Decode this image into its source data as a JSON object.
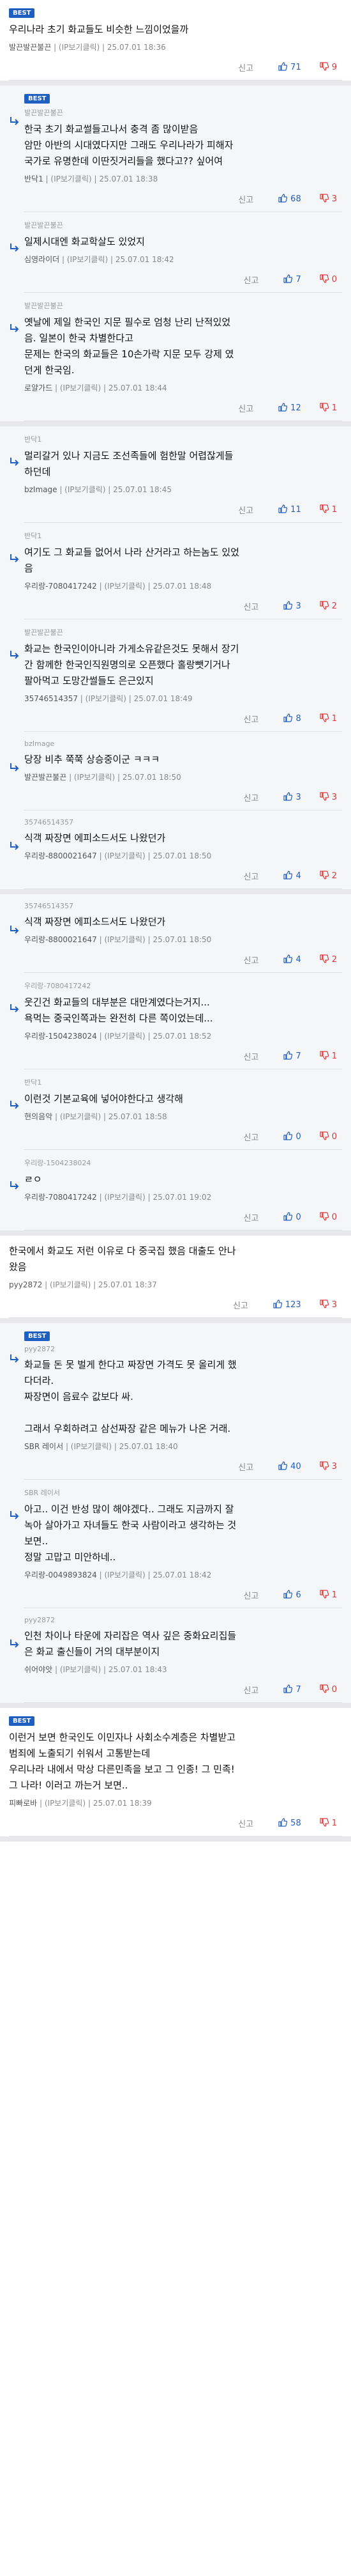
{
  "ui": {
    "report_label": "신고",
    "best_label": "BEST",
    "colors": {
      "best_badge": "#1f5fc0",
      "upvote": "#1f5fc0",
      "downvote": "#d63a3a"
    },
    "icons": {
      "up": "thumbs-up-icon",
      "down": "thumbs-down-icon",
      "reply": "reply-arrow-icon"
    }
  },
  "threads": [
    {
      "comments": [
        {
          "kind": "top",
          "best": true,
          "text": "우리나라 초기 화교들도 비슷한 느낌이었을까",
          "nick": "발끈발끈불끈",
          "ip": "(IP보기클릭)",
          "date": "25.07.01 18:36",
          "up": "71",
          "down": "9"
        }
      ]
    },
    {
      "comments": [
        {
          "kind": "reply",
          "best": true,
          "parent": "발끈발끈불끈",
          "text": "한국 초기 화교썰들고나서 충격 좀 많이받음\n암만 아반의 시대였다지만 그래도 우리나라가 피해자\n국가로 유명한데 이딴짓거리들을 했다고?? 싶어여",
          "nick": "반닥1",
          "ip": "(IP보기클릭)",
          "date": "25.07.01 18:38",
          "up": "68",
          "down": "3"
        },
        {
          "kind": "reply",
          "best": false,
          "parent": "발끈발끈불끈",
          "text": "일제시대엔 화교학살도 있었지",
          "nick": "심영라이더",
          "ip": "(IP보기클릭)",
          "date": "25.07.01 18:42",
          "up": "7",
          "down": "0"
        },
        {
          "kind": "reply",
          "best": false,
          "parent": "발끈발끈불끈",
          "text": "옛날에 제일 한국인 지문 필수로 엄청 난리 난적있었\n음. 일본이 한국 차별한다고\n문제는 한국의 화교들은 10손가락 지문 모두 강제 였\n던게 한국임.",
          "nick": "로얄가드",
          "ip": "(IP보기클릭)",
          "date": "25.07.01 18:44",
          "up": "12",
          "down": "1"
        }
      ]
    },
    {
      "comments": [
        {
          "kind": "reply",
          "best": false,
          "parent": "반닥1",
          "text": "멀리갈거 있나 지금도 조선족들에 험한말 어렵잖게들\n하던데",
          "nick": "bzImage",
          "ip": "(IP보기클릭)",
          "date": "25.07.01 18:45",
          "up": "11",
          "down": "1"
        },
        {
          "kind": "reply",
          "best": false,
          "parent": "반닥1",
          "text": "여기도 그 화교들 없어서 나라 산거라고 하는놈도 있었\n음",
          "nick": "우리랑-7080417242",
          "ip": "(IP보기클릭)",
          "date": "25.07.01 18:48",
          "up": "3",
          "down": "2"
        },
        {
          "kind": "reply",
          "best": false,
          "parent": "발끈발끈불끈",
          "text": "화교는 한국인이아니라 가게소유같은것도 못해서 장기\n간 함께한 한국인직원명의로 오픈했다 홀랑뺏기거나\n팔아먹고 도망간썰들도 은근있지",
          "nick": "35746514357",
          "ip": "(IP보기클릭)",
          "date": "25.07.01 18:49",
          "up": "8",
          "down": "1"
        },
        {
          "kind": "reply",
          "best": false,
          "parent": "bzImage",
          "text": "당장 비추 쭉쭉 상승중이군 ㅋㅋㅋ",
          "nick": "발끈발끈불끈",
          "ip": "(IP보기클릭)",
          "date": "25.07.01 18:50",
          "up": "3",
          "down": "3"
        },
        {
          "kind": "reply",
          "best": false,
          "parent": "35746514357",
          "text": "식객 짜장면 에피소드서도 나왔던가",
          "nick": "우리랑-8800021647",
          "ip": "(IP보기클릭)",
          "date": "25.07.01 18:50",
          "up": "4",
          "down": "2"
        }
      ]
    },
    {
      "comments": [
        {
          "kind": "reply",
          "best": false,
          "parent": "35746514357",
          "text": "식객 짜장면 에피소드서도 나왔던가",
          "nick": "우리랑-8800021647",
          "ip": "(IP보기클릭)",
          "date": "25.07.01 18:50",
          "up": "4",
          "down": "2"
        },
        {
          "kind": "reply",
          "best": false,
          "parent": "우리랑-7080417242",
          "text": "웃긴건 화교들의 대부분은 대만계였다는거지...\n욕먹는 중국인쪽과는 완전히 다른 쪽이었는데...",
          "nick": "우리랑-1504238024",
          "ip": "(IP보기클릭)",
          "date": "25.07.01 18:52",
          "up": "7",
          "down": "1"
        },
        {
          "kind": "reply",
          "best": false,
          "parent": "반닥1",
          "text": "이런것 기본교육에 넣어야한다고 생각해",
          "nick": "현의음악",
          "ip": "(IP보기클릭)",
          "date": "25.07.01 18:58",
          "up": "0",
          "down": "0"
        },
        {
          "kind": "reply",
          "best": false,
          "parent": "우리랑-1504238024",
          "text": "ㄹㅇ",
          "nick": "우리랑-7080417242",
          "ip": "(IP보기클릭)",
          "date": "25.07.01 19:02",
          "up": "0",
          "down": "0"
        }
      ]
    },
    {
      "comments": [
        {
          "kind": "top",
          "best": false,
          "text": "한국에서 화교도 저런 이유로 다 중국집 했음 대출도 안나\n왔음",
          "nick": "pyy2872",
          "ip": "(IP보기클릭)",
          "date": "25.07.01 18:37",
          "up": "123",
          "down": "3"
        }
      ]
    },
    {
      "comments": [
        {
          "kind": "reply",
          "best": true,
          "parent": "pyy2872",
          "text": "화교들 돈 못 벌게 한다고 짜장면 가격도 못 올리게 했\n다더라.\n짜장면이 음료수 값보다 싸.\n\n그래서 우회하려고 삼선짜장 같은 메뉴가 나온 거래.",
          "nick": "SBR 레이서",
          "ip": "(IP보기클릭)",
          "date": "25.07.01 18:40",
          "up": "40",
          "down": "3"
        },
        {
          "kind": "reply",
          "best": false,
          "parent": "SBR 레이서",
          "text": "아고.. 이건 반성 많이 해야겠다.. 그래도 지금까지 잘\n녹아 살아가고 자녀들도 한국 사람이라고 생각하는 것\n보면..\n정말 고맙고 미안하네..",
          "nick": "우리랑-0049893824",
          "ip": "(IP보기클릭)",
          "date": "25.07.01 18:42",
          "up": "6",
          "down": "1"
        },
        {
          "kind": "reply",
          "best": false,
          "parent": "pyy2872",
          "text": "인천 차이나 타운에 자리잡은 역사 깊은 중화요리집들\n은 화교 출신들이 거의 대부분이지",
          "nick": "쉬어야앗",
          "ip": "(IP보기클릭)",
          "date": "25.07.01 18:43",
          "up": "7",
          "down": "0"
        }
      ]
    },
    {
      "comments": [
        {
          "kind": "top",
          "best": true,
          "text": "이런거 보면 한국인도 이민자나 사회소수계층은 차별받고\n범죄에 노출되기 쉬워서 고통받는데\n우리나라 내에서 막상 다른민족을 보고 그 인종! 그 민족!\n그 나라! 이러고 까는거 보면..",
          "nick": "피빠로바",
          "ip": "(IP보기클릭)",
          "date": "25.07.01 18:39",
          "up": "58",
          "down": "1"
        }
      ]
    }
  ]
}
